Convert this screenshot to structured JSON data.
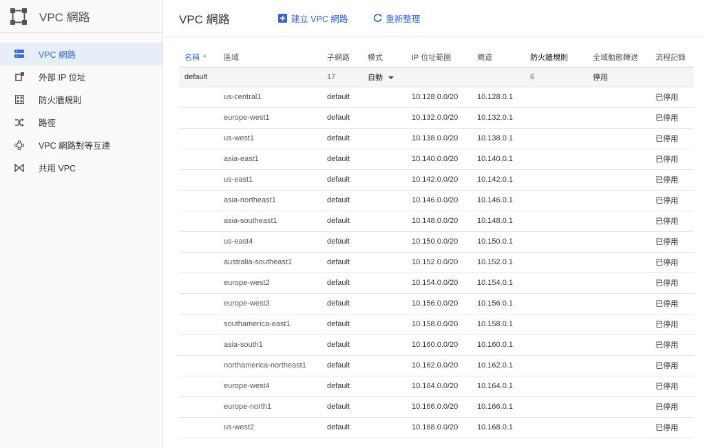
{
  "app": {
    "product_title": "VPC 網路",
    "product_icon": "vpc-network-icon"
  },
  "sidebar": {
    "items": [
      {
        "label": "VPC 網路",
        "icon": "vpc-network-icon",
        "active": true
      },
      {
        "label": "外部 IP 位址",
        "icon": "external-ip-icon",
        "active": false
      },
      {
        "label": "防火牆規則",
        "icon": "firewall-icon",
        "active": false
      },
      {
        "label": "路徑",
        "icon": "routes-icon",
        "active": false
      },
      {
        "label": "VPC 網路對等互連",
        "icon": "peering-icon",
        "active": false
      },
      {
        "label": "共用 VPC",
        "icon": "shared-vpc-icon",
        "active": false
      }
    ]
  },
  "header": {
    "title": "VPC 網路",
    "create_label": "建立 VPC 網路",
    "refresh_label": "重新整理"
  },
  "colors": {
    "accent": "#3367d6",
    "active_nav_bg": "#e8eef8"
  },
  "table": {
    "columns": {
      "name": "名稱",
      "region": "區域",
      "subnets": "子網路",
      "mode": "模式",
      "ip_range": "IP 位址範圍",
      "gateway": "閘道",
      "firewall": "防火牆規則",
      "global_routing": "全域動態轉送",
      "flow_logs": "流程記錄"
    },
    "sort_indicator": "^",
    "network": {
      "name": "default",
      "subnets": "17",
      "mode": "自動",
      "firewall": "6",
      "global_routing": "停用"
    },
    "rows": [
      {
        "region": "us-central1",
        "subnet": "default",
        "ip_range": "10.128.0.0/20",
        "gateway": "10.128.0.1",
        "flow_logs": "已停用"
      },
      {
        "region": "europe-west1",
        "subnet": "default",
        "ip_range": "10.132.0.0/20",
        "gateway": "10.132.0.1",
        "flow_logs": "已停用"
      },
      {
        "region": "us-west1",
        "subnet": "default",
        "ip_range": "10.138.0.0/20",
        "gateway": "10.138.0.1",
        "flow_logs": "已停用"
      },
      {
        "region": "asia-east1",
        "subnet": "default",
        "ip_range": "10.140.0.0/20",
        "gateway": "10.140.0.1",
        "flow_logs": "已停用"
      },
      {
        "region": "us-east1",
        "subnet": "default",
        "ip_range": "10.142.0.0/20",
        "gateway": "10.142.0.1",
        "flow_logs": "已停用"
      },
      {
        "region": "asia-northeast1",
        "subnet": "default",
        "ip_range": "10.146.0.0/20",
        "gateway": "10.146.0.1",
        "flow_logs": "已停用"
      },
      {
        "region": "asia-southeast1",
        "subnet": "default",
        "ip_range": "10.148.0.0/20",
        "gateway": "10.148.0.1",
        "flow_logs": "已停用"
      },
      {
        "region": "us-east4",
        "subnet": "default",
        "ip_range": "10.150.0.0/20",
        "gateway": "10.150.0.1",
        "flow_logs": "已停用"
      },
      {
        "region": "australia-southeast1",
        "subnet": "default",
        "ip_range": "10.152.0.0/20",
        "gateway": "10.152.0.1",
        "flow_logs": "已停用"
      },
      {
        "region": "europe-west2",
        "subnet": "default",
        "ip_range": "10.154.0.0/20",
        "gateway": "10.154.0.1",
        "flow_logs": "已停用"
      },
      {
        "region": "europe-west3",
        "subnet": "default",
        "ip_range": "10.156.0.0/20",
        "gateway": "10.156.0.1",
        "flow_logs": "已停用"
      },
      {
        "region": "southamerica-east1",
        "subnet": "default",
        "ip_range": "10.158.0.0/20",
        "gateway": "10.158.0.1",
        "flow_logs": "已停用"
      },
      {
        "region": "asia-south1",
        "subnet": "default",
        "ip_range": "10.160.0.0/20",
        "gateway": "10.160.0.1",
        "flow_logs": "已停用"
      },
      {
        "region": "northamerica-northeast1",
        "subnet": "default",
        "ip_range": "10.162.0.0/20",
        "gateway": "10.162.0.1",
        "flow_logs": "已停用"
      },
      {
        "region": "europe-west4",
        "subnet": "default",
        "ip_range": "10.164.0.0/20",
        "gateway": "10.164.0.1",
        "flow_logs": "已停用"
      },
      {
        "region": "europe-north1",
        "subnet": "default",
        "ip_range": "10.166.0.0/20",
        "gateway": "10.166.0.1",
        "flow_logs": "已停用"
      },
      {
        "region": "us-west2",
        "subnet": "default",
        "ip_range": "10.168.0.0/20",
        "gateway": "10.168.0.1",
        "flow_logs": "已停用"
      }
    ]
  }
}
